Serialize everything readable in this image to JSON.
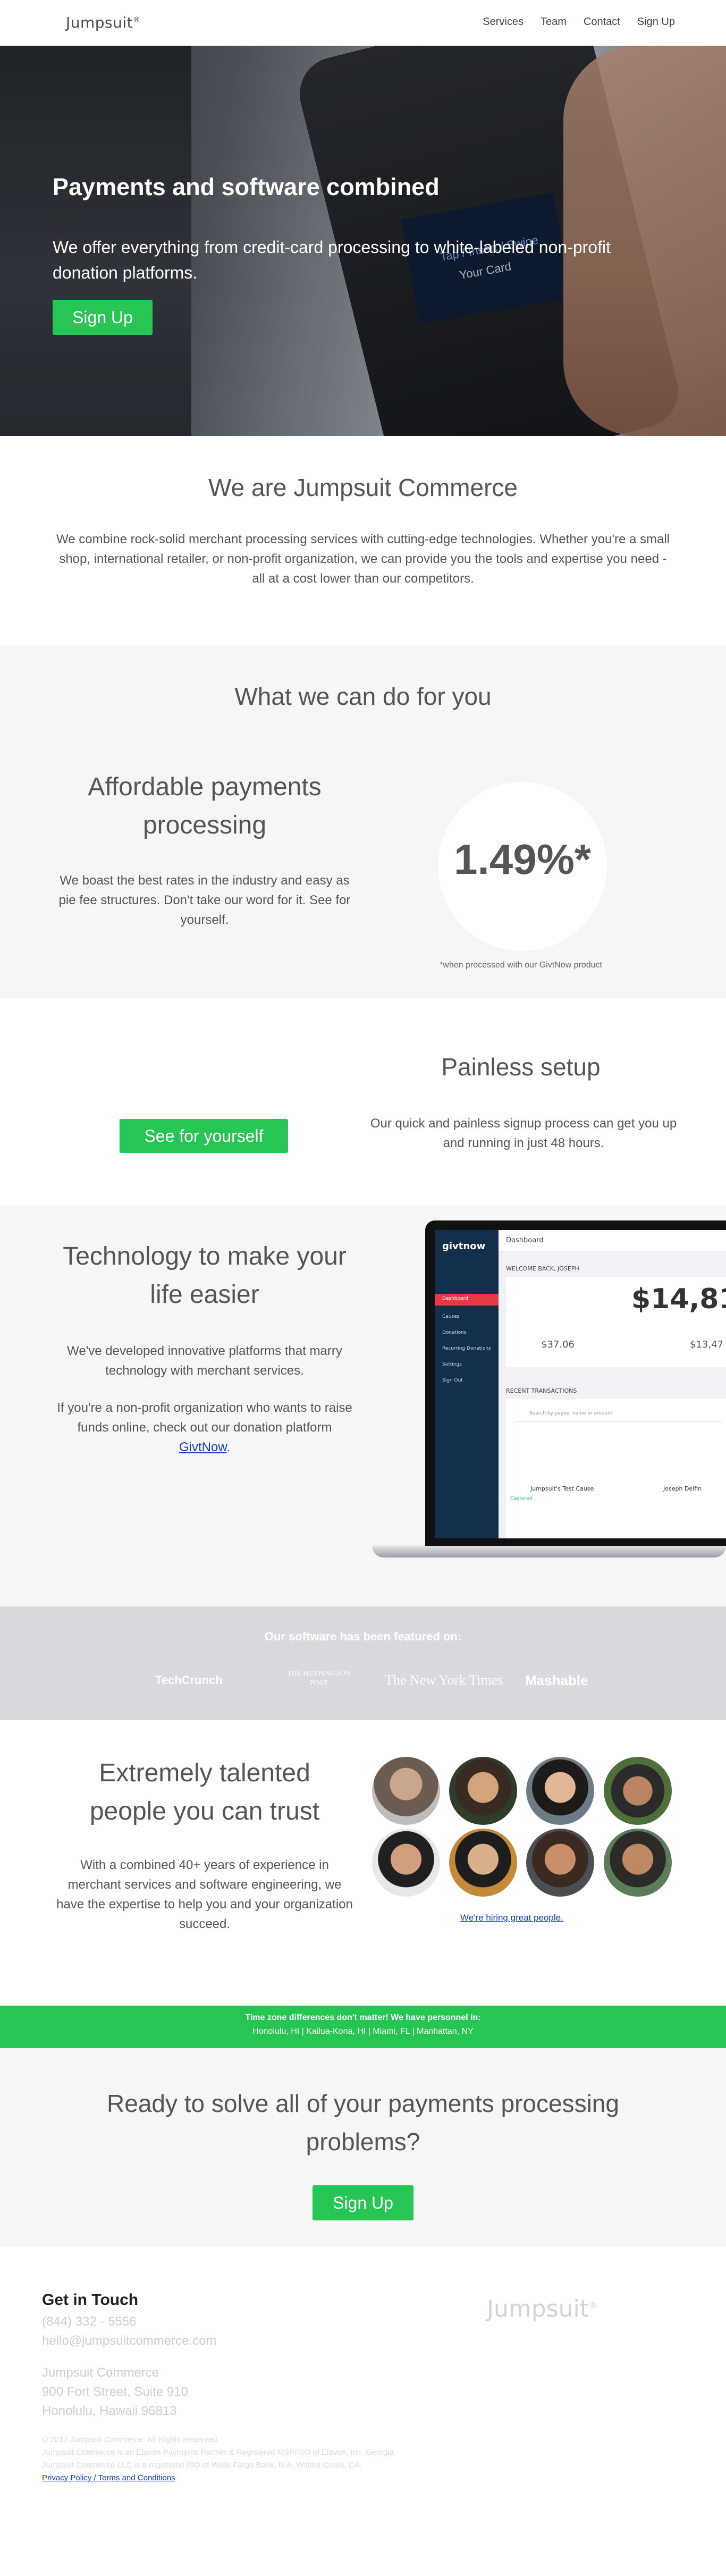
{
  "nav": {
    "logo": "Jumpsuit",
    "logo_mark": "®",
    "links": [
      "Services",
      "Team",
      "Contact",
      "Sign Up"
    ]
  },
  "hero": {
    "title": "Payments and software combined",
    "subtitle": "We offer everything from credit-card processing to white-labeled non-profit donation platforms.",
    "cta": "Sign Up",
    "terminal_text_1": "Tap / Insert / Swipe",
    "terminal_text_2": "Your Card"
  },
  "about": {
    "title": "We are Jumpsuit Commerce",
    "body": "We combine rock-solid merchant processing services with cutting-edge technologies. Whether you're a small shop, international retailer, or non-profit organization, we can provide you the tools and expertise you need - all at a cost lower than our competitors."
  },
  "services": {
    "title": "What we can do for you",
    "affordable_title": "Affordable payments processing",
    "affordable_body": "We boast the best rates in the industry and easy as pie fee structures. Don't take our word for it. See for yourself.",
    "rate": "1.49%*",
    "rate_note": "*when processed with our GivtNow product"
  },
  "setup": {
    "cta": "See for yourself",
    "title": "Painless setup",
    "body": "Our quick and painless signup process can get you up and running in just 48 hours."
  },
  "tech": {
    "title": "Technology to make your life easier",
    "body1": "We've developed innovative platforms that marry technology with merchant services.",
    "body2": "If you're a non-profit organization who wants to raise funds online, check out our donation platform ",
    "link": "GivtNow",
    "body2_end": ".",
    "app": {
      "brand": "givtnow",
      "header": "Dashboard",
      "welcome": "WELCOME BACK, JOSEPH",
      "big_amount": "$14,81",
      "stat1": "$37.06",
      "stat2": "$13,47",
      "recent": "RECENT TRANSACTIONS",
      "search_ph": "Search by payee, name or amount",
      "cause": "Jumpsuit's Test Cause",
      "payee": "Joseph Delfin",
      "status": "Captured",
      "menu": [
        "Dashboard",
        "Causes",
        "Donations",
        "Recurring Donations",
        "Settings",
        "Sign Out"
      ]
    }
  },
  "featured": {
    "title": "Our software has been featured on:",
    "logos": [
      "TechCrunch",
      "THE HUFFINGTON POST",
      "The New York Times",
      "Mashable"
    ]
  },
  "team": {
    "title": "Extremely talented people you can trust",
    "body": "With a combined 40+ years of experience in merchant services and software engineering, we have the expertise to help you and your organization succeed.",
    "hiring": "We're hiring great people."
  },
  "timezone": {
    "line1": "Time zone differences don't matter! We have personnel in:",
    "line2": "Honolulu, HI | Kailua-Kona, HI | Miami, FL | Manhattan, NY"
  },
  "cta": {
    "title": "Ready to solve all of your payments processing problems?",
    "button": "Sign Up"
  },
  "footer": {
    "title": "Get in Touch",
    "phone": "(844) 332 - 5556",
    "email": "hello@jumpsuitcommerce.com",
    "addr1": "Jumpsuit Commerce",
    "addr2": "900 Fort Street, Suite 910",
    "addr3": "Honolulu, Hawaii 96813",
    "legal1": "© 2017 Jumpsuit Commerce. All Rights Reserved.",
    "legal2": "Jumpsuit Commerce is an Elavon Payments Partner & Registered MSP/ISO of Elavon, Inc. Georgia.",
    "legal3": "Jumpsuit Commerce LLC is a registered ISO of Wells Fargo Bank, N.A. Walnut Creek, CA.",
    "legal_link": "Privacy Policy / Terms and Conditions",
    "logo": "Jumpsuit"
  },
  "colors": {
    "accent": "#27c553",
    "text": "#555555",
    "grey_bg": "#f6f6f6",
    "featured_bg": "#d8dadd"
  }
}
